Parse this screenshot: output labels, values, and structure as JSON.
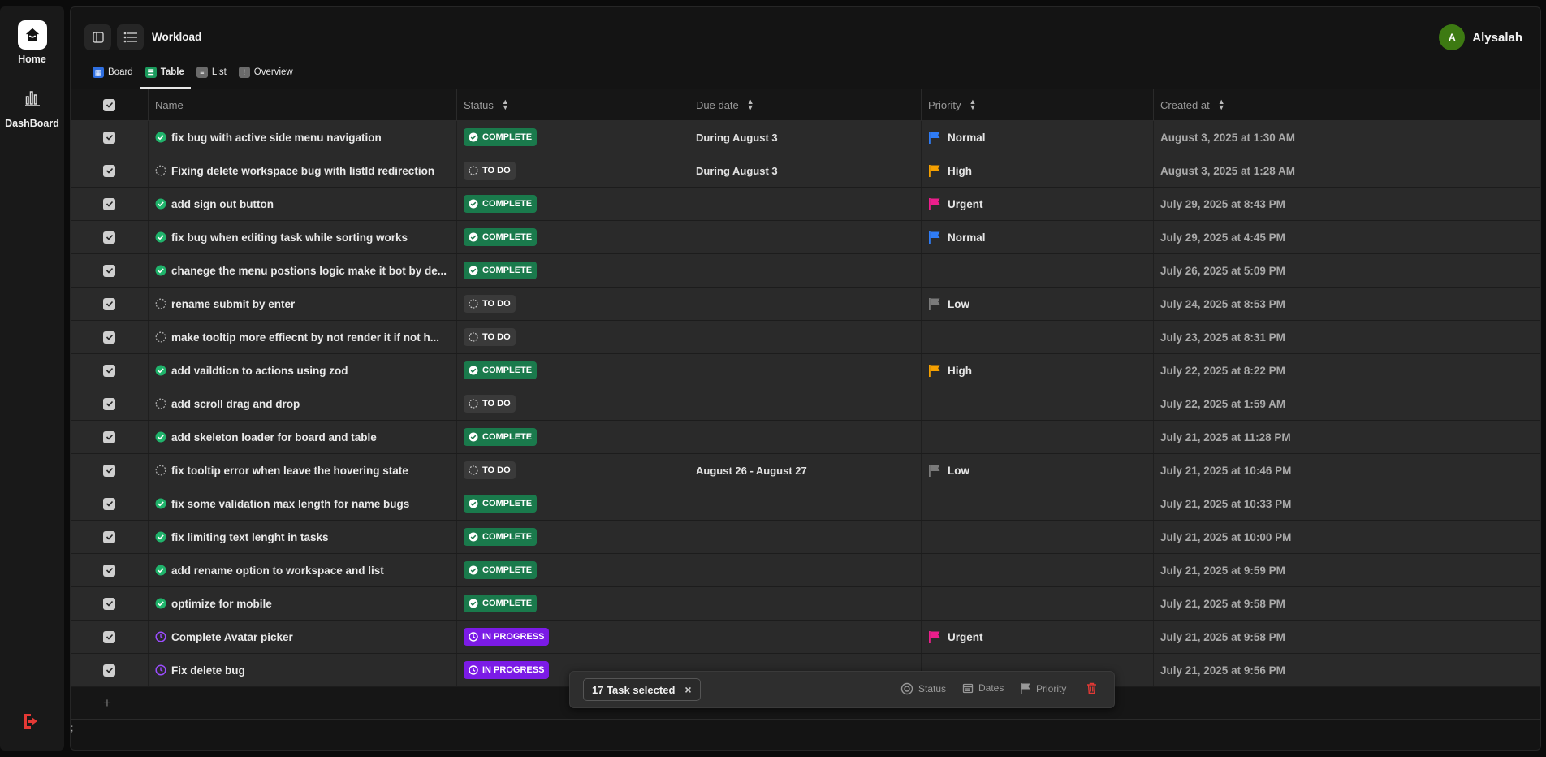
{
  "nav": {
    "home_label": "Home",
    "dashboard_label": "DashBoard"
  },
  "header": {
    "title": "Workload",
    "user_initial": "A",
    "user_name": "Alysalah"
  },
  "tabs": [
    {
      "label": "Board",
      "icon": "board-icon",
      "color": "#2f6fe0"
    },
    {
      "label": "Table",
      "icon": "table-icon",
      "color": "#1a9a5c",
      "active": true
    },
    {
      "label": "List",
      "icon": "list-icon",
      "color": "#6b6b6b"
    },
    {
      "label": "Overview",
      "icon": "overview-icon",
      "color": "#6b6b6b"
    }
  ],
  "columns": {
    "name": "Name",
    "status": "Status",
    "due": "Due date",
    "priority": "Priority",
    "created": "Created at"
  },
  "status_colors": {
    "COMPLETE": "#1a7a4c",
    "TO DO": "#3a3a3a",
    "IN PROGRESS": "#7b1be6"
  },
  "priority_colors": {
    "Normal": "#2f7cf6",
    "High": "#f5a000",
    "Urgent": "#ec1e8c",
    "Low": "#7a7a7a"
  },
  "rows": [
    {
      "name": "fix bug with active side menu navigation",
      "status": "COMPLETE",
      "due": "During August 3",
      "priority": "Normal",
      "created": "August 3, 2025 at 1:30 AM"
    },
    {
      "name": "Fixing delete workspace bug with listId redirection",
      "status": "TO DO",
      "due": "During August 3",
      "priority": "High",
      "created": "August 3, 2025 at 1:28 AM"
    },
    {
      "name": "add sign out button",
      "status": "COMPLETE",
      "due": "",
      "priority": "Urgent",
      "created": "July 29, 2025 at 8:43 PM"
    },
    {
      "name": "fix bug when editing task while sorting works",
      "status": "COMPLETE",
      "due": "",
      "priority": "Normal",
      "created": "July 29, 2025 at 4:45 PM"
    },
    {
      "name": "chanege the menu postions logic make it bot by de...",
      "status": "COMPLETE",
      "due": "",
      "priority": "",
      "created": "July 26, 2025 at 5:09 PM"
    },
    {
      "name": "rename submit by enter",
      "status": "TO DO",
      "due": "",
      "priority": "Low",
      "created": "July 24, 2025 at 8:53 PM"
    },
    {
      "name": "make tooltip more effiecnt by not render it if not h...",
      "status": "TO DO",
      "due": "",
      "priority": "",
      "created": "July 23, 2025 at 8:31 PM"
    },
    {
      "name": "add vaildtion to actions using zod",
      "status": "COMPLETE",
      "due": "",
      "priority": "High",
      "created": "July 22, 2025 at 8:22 PM"
    },
    {
      "name": "add scroll drag and drop",
      "status": "TO DO",
      "due": "",
      "priority": "",
      "created": "July 22, 2025 at 1:59 AM"
    },
    {
      "name": "add skeleton loader for board and table",
      "status": "COMPLETE",
      "due": "",
      "priority": "",
      "created": "July 21, 2025 at 11:28 PM"
    },
    {
      "name": "fix tooltip error when leave the hovering state",
      "status": "TO DO",
      "due": "August 26 - August 27",
      "priority": "Low",
      "created": "July 21, 2025 at 10:46 PM"
    },
    {
      "name": "fix some validation max length for name bugs",
      "status": "COMPLETE",
      "due": "",
      "priority": "",
      "created": "July 21, 2025 at 10:33 PM"
    },
    {
      "name": "fix limiting text lenght in tasks",
      "status": "COMPLETE",
      "due": "",
      "priority": "",
      "created": "July 21, 2025 at 10:00 PM"
    },
    {
      "name": "add rename option to workspace and list",
      "status": "COMPLETE",
      "due": "",
      "priority": "",
      "created": "July 21, 2025 at 9:59 PM"
    },
    {
      "name": "optimize for mobile",
      "status": "COMPLETE",
      "due": "",
      "priority": "",
      "created": "July 21, 2025 at 9:58 PM"
    },
    {
      "name": "Complete Avatar picker",
      "status": "IN PROGRESS",
      "due": "",
      "priority": "Urgent",
      "created": "July 21, 2025 at 9:58 PM"
    },
    {
      "name": "Fix delete bug",
      "status": "IN PROGRESS",
      "due": "",
      "priority": "",
      "created": "July 21, 2025 at 9:56 PM"
    }
  ],
  "add_row_symbol": "+",
  "footer_text": ";",
  "selection": {
    "count_label": "17 Task selected",
    "actions": [
      "Status",
      "Dates",
      "Priority"
    ]
  }
}
